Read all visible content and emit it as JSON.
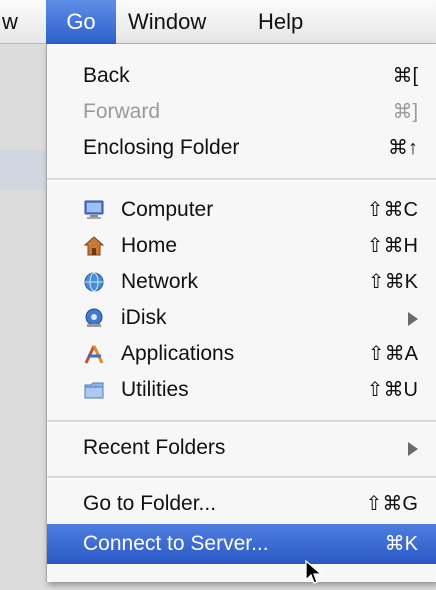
{
  "menubar": {
    "prev_fragment": "w",
    "go": "Go",
    "window": "Window",
    "help": "Help"
  },
  "menu": {
    "back": {
      "label": "Back",
      "shortcut": "⌘["
    },
    "forward": {
      "label": "Forward",
      "shortcut": "⌘]"
    },
    "enclosing": {
      "label": "Enclosing Folder",
      "shortcut": "⌘↑"
    },
    "computer": {
      "label": "Computer",
      "shortcut": "⇧⌘C",
      "icon": "computer-icon"
    },
    "home": {
      "label": "Home",
      "shortcut": "⇧⌘H",
      "icon": "home-icon"
    },
    "network": {
      "label": "Network",
      "shortcut": "⇧⌘K",
      "icon": "network-icon"
    },
    "idisk": {
      "label": "iDisk",
      "icon": "idisk-icon"
    },
    "applications": {
      "label": "Applications",
      "shortcut": "⇧⌘A",
      "icon": "applications-icon"
    },
    "utilities": {
      "label": "Utilities",
      "shortcut": "⇧⌘U",
      "icon": "utilities-folder-icon"
    },
    "recent": {
      "label": "Recent Folders"
    },
    "goto": {
      "label": "Go to Folder...",
      "shortcut": "⇧⌘G"
    },
    "connect": {
      "label": "Connect to Server...",
      "shortcut": "⌘K"
    }
  },
  "colors": {
    "highlight": "#3d6bd6",
    "disabled_text": "#9a9a9a"
  }
}
